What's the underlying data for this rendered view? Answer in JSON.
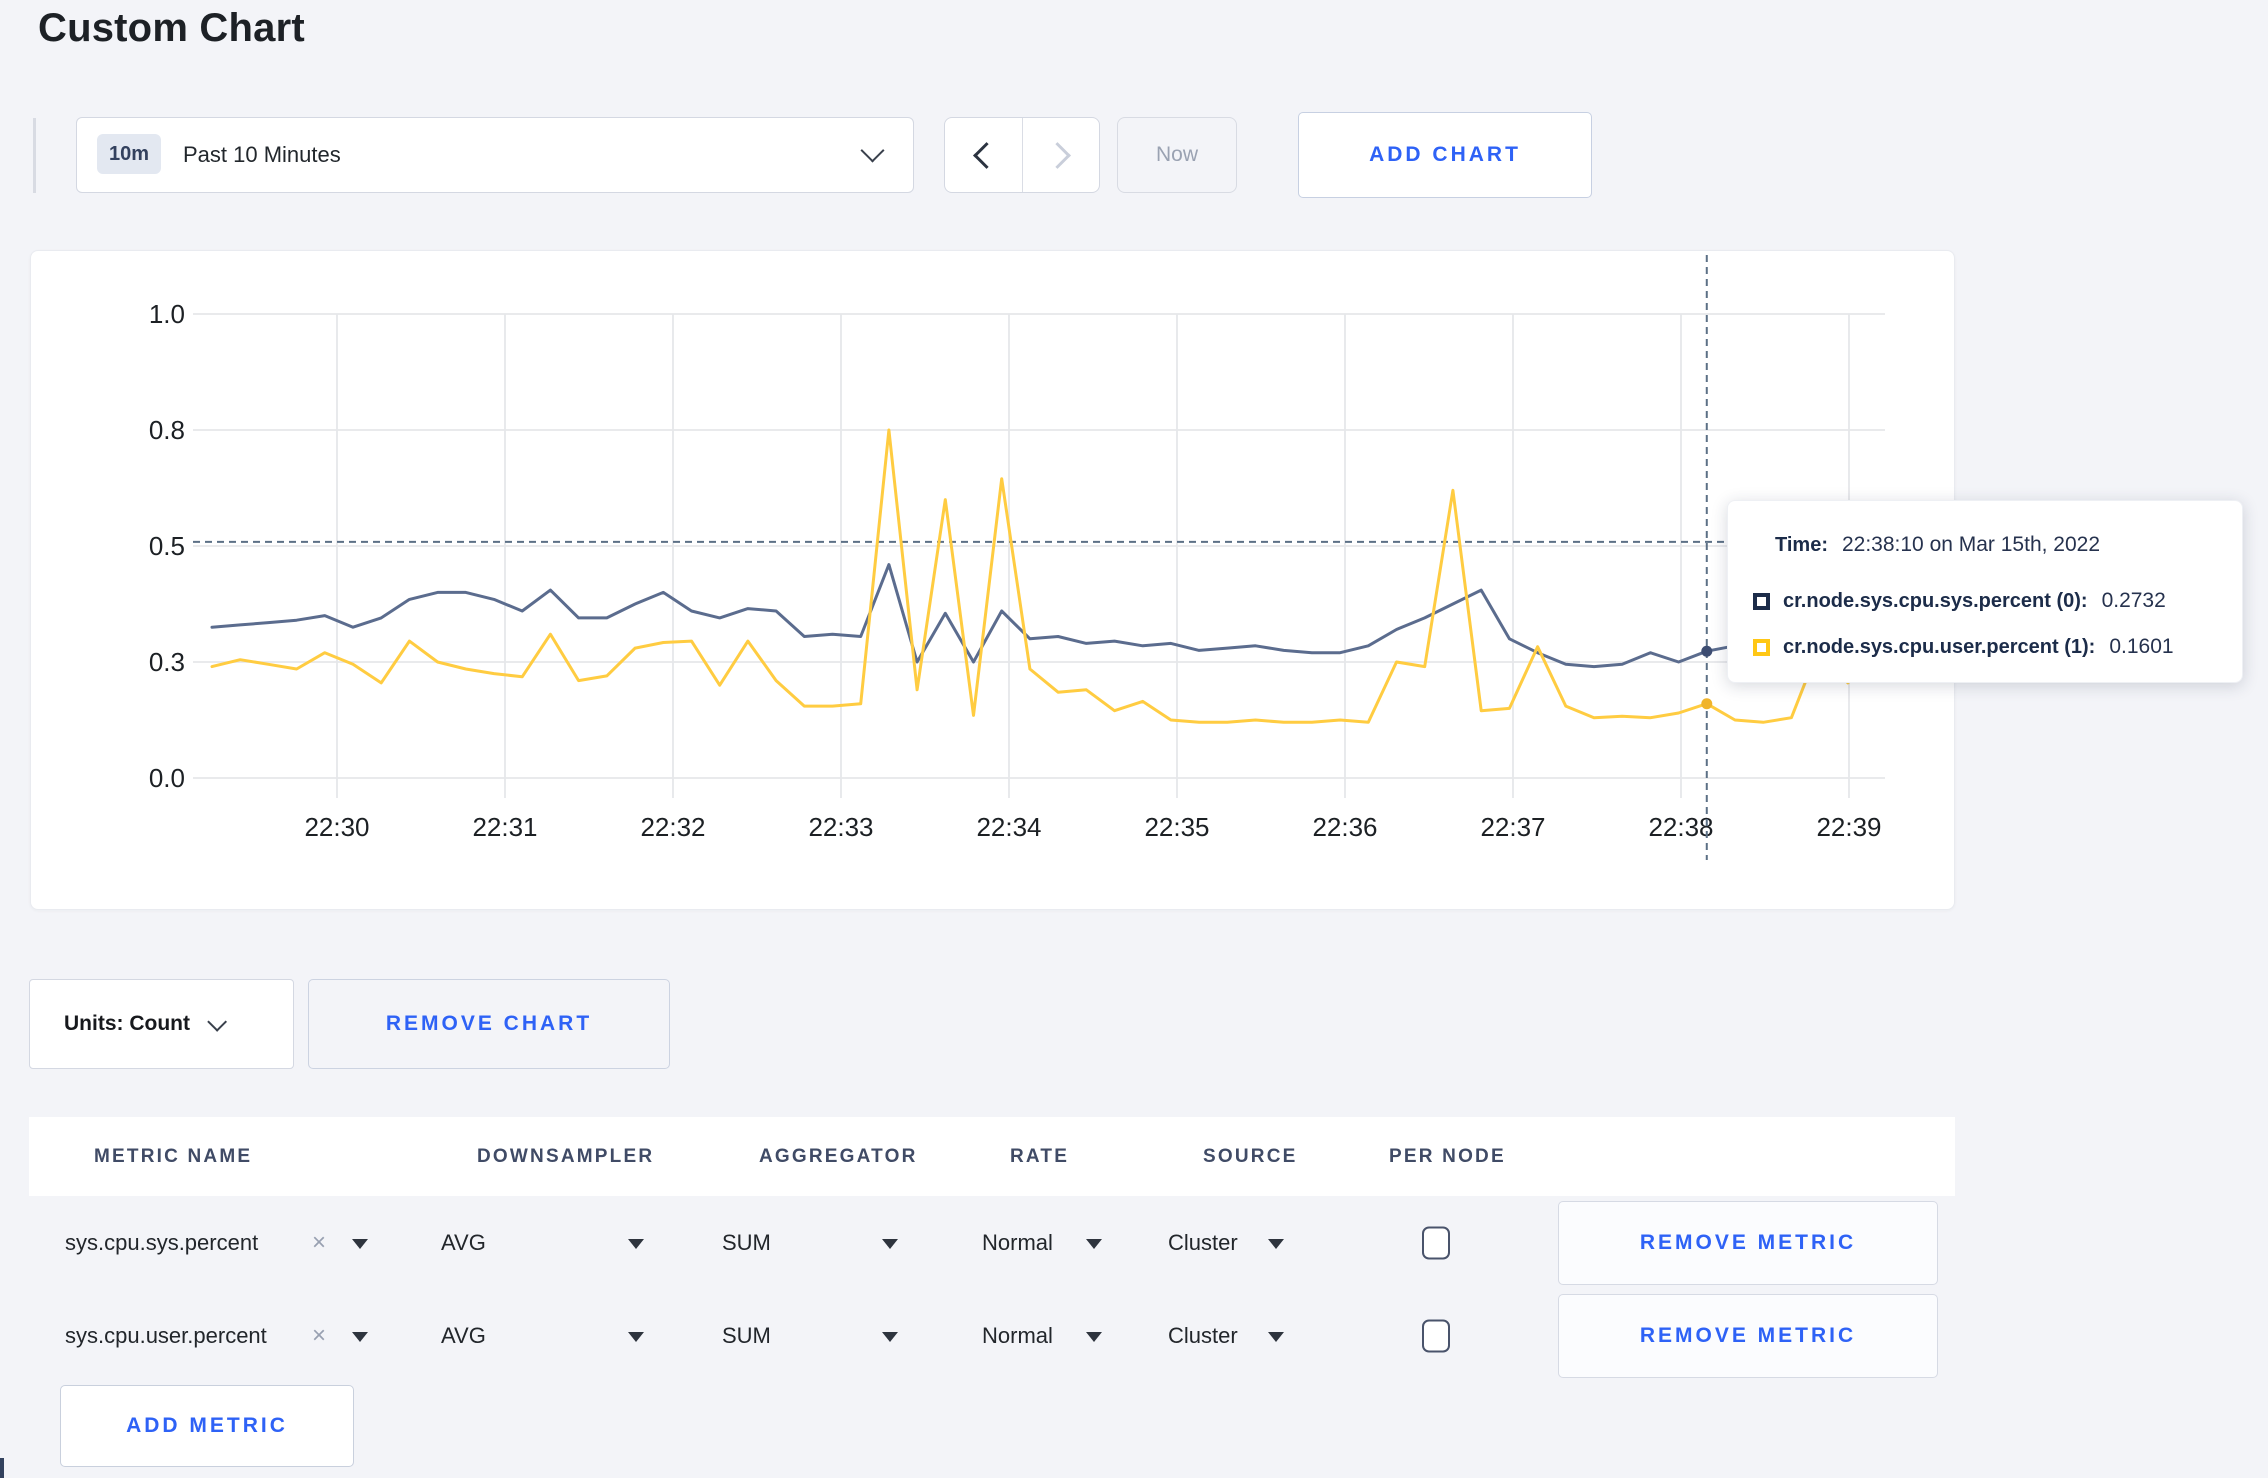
{
  "page": {
    "title": "Custom Chart",
    "background": "#f3f4f8",
    "accent_blue": "#2e62f6"
  },
  "toolbar": {
    "time_badge": "10m",
    "time_label": "Past 10 Minutes",
    "now_label": "Now",
    "add_chart_label": "ADD CHART"
  },
  "chart_data": {
    "type": "line",
    "title": "",
    "xlabel": "",
    "ylabel": "",
    "grid": true,
    "legend_position": "tooltip-only",
    "ylim": [
      0,
      1
    ],
    "y_ticks": [
      {
        "label": "1.0",
        "v": 1.0
      },
      {
        "label": "0.8",
        "v": 0.75
      },
      {
        "label": "0.5",
        "v": 0.5
      },
      {
        "label": "0.3",
        "v": 0.25
      },
      {
        "label": "0.0",
        "v": 0.0
      }
    ],
    "x_ticks": [
      "22:30",
      "22:31",
      "22:32",
      "22:33",
      "22:34",
      "22:35",
      "22:36",
      "22:37",
      "22:38",
      "22:39"
    ],
    "sample_interval_seconds": 10,
    "series": [
      {
        "name": "cr.node.sys.cpu.sys.percent",
        "color": "#5b6c8e",
        "dot_color": "#3d4d72",
        "values": [
          0.325,
          0.33,
          0.335,
          0.34,
          0.35,
          0.325,
          0.345,
          0.385,
          0.4,
          0.4,
          0.385,
          0.36,
          0.405,
          0.345,
          0.345,
          0.375,
          0.4,
          0.36,
          0.345,
          0.365,
          0.36,
          0.305,
          0.31,
          0.305,
          0.46,
          0.25,
          0.355,
          0.25,
          0.36,
          0.3,
          0.305,
          0.29,
          0.295,
          0.285,
          0.29,
          0.275,
          0.28,
          0.285,
          0.275,
          0.27,
          0.27,
          0.285,
          0.32,
          0.345,
          0.375,
          0.405,
          0.3,
          0.27,
          0.245,
          0.24,
          0.245,
          0.27,
          0.25,
          0.2732,
          0.285,
          0.29,
          0.3,
          0.31,
          0.3,
          0.305
        ]
      },
      {
        "name": "cr.node.sys.cpu.user.percent",
        "color": "#ffcc41",
        "dot_color": "#f0b42c",
        "values": [
          0.24,
          0.255,
          0.245,
          0.235,
          0.27,
          0.245,
          0.205,
          0.295,
          0.25,
          0.235,
          0.225,
          0.218,
          0.31,
          0.21,
          0.22,
          0.28,
          0.292,
          0.295,
          0.2,
          0.295,
          0.21,
          0.155,
          0.155,
          0.16,
          0.75,
          0.19,
          0.6,
          0.135,
          0.645,
          0.235,
          0.185,
          0.19,
          0.145,
          0.165,
          0.125,
          0.12,
          0.12,
          0.125,
          0.12,
          0.12,
          0.125,
          0.12,
          0.25,
          0.24,
          0.62,
          0.145,
          0.15,
          0.283,
          0.155,
          0.13,
          0.133,
          0.13,
          0.14,
          0.1601,
          0.125,
          0.12,
          0.13,
          0.285,
          0.205,
          0.255
        ]
      }
    ],
    "crosshair": {
      "point_index": 53,
      "time": "22:38:10",
      "hline_value": 0.509
    }
  },
  "tooltip": {
    "time_label": "Time:",
    "time_value": "22:38:10 on Mar 15th, 2022",
    "rows": [
      {
        "name": "cr.node.sys.cpu.sys.percent (0):",
        "value": "0.2732",
        "swatch": "#1c2c49"
      },
      {
        "name": "cr.node.sys.cpu.user.percent (1):",
        "value": "0.1601",
        "swatch": "#ffc715"
      }
    ]
  },
  "units": {
    "label": "Units: Count",
    "remove_chart_label": "REMOVE CHART"
  },
  "metrics_table": {
    "headers": [
      "METRIC NAME",
      "DOWNSAMPLER",
      "AGGREGATOR",
      "RATE",
      "SOURCE",
      "PER NODE"
    ],
    "remove_icon": "×",
    "rows": [
      {
        "metric": "sys.cpu.sys.percent",
        "downsampler": "AVG",
        "aggregator": "SUM",
        "rate": "Normal",
        "source": "Cluster",
        "per_node_checked": false,
        "remove_label": "REMOVE METRIC"
      },
      {
        "metric": "sys.cpu.user.percent",
        "downsampler": "AVG",
        "aggregator": "SUM",
        "rate": "Normal",
        "source": "Cluster",
        "per_node_checked": false,
        "remove_label": "REMOVE METRIC"
      }
    ],
    "add_metric_label": "ADD METRIC"
  }
}
